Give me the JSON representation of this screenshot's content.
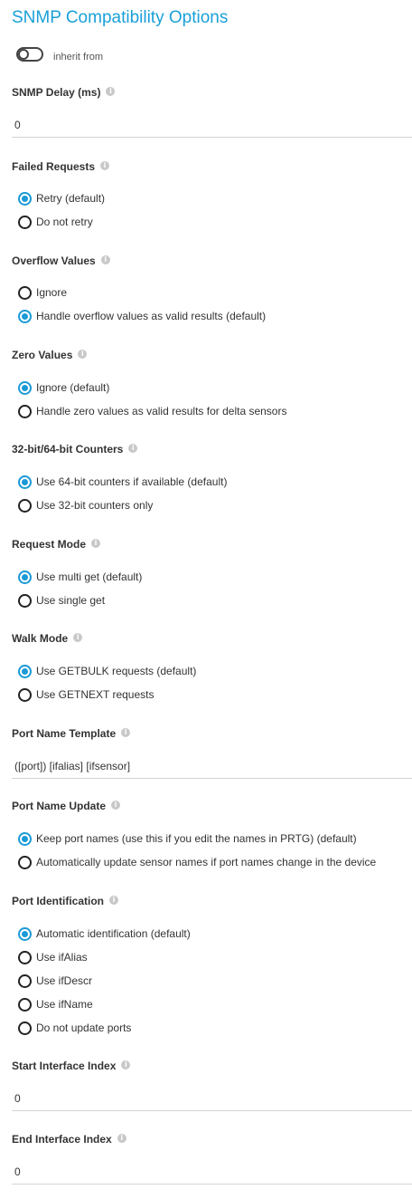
{
  "title": "SNMP Compatibility Options",
  "inherit": {
    "label": "inherit from",
    "on": false
  },
  "snmp_delay": {
    "label": "SNMP Delay (ms)",
    "value": "0"
  },
  "failed_requests": {
    "label": "Failed Requests",
    "options": [
      {
        "label": "Retry (default)",
        "checked": true
      },
      {
        "label": "Do not retry",
        "checked": false
      }
    ]
  },
  "overflow_values": {
    "label": "Overflow Values",
    "options": [
      {
        "label": "Ignore",
        "checked": false
      },
      {
        "label": "Handle overflow values as valid results (default)",
        "checked": true
      }
    ]
  },
  "zero_values": {
    "label": "Zero Values",
    "options": [
      {
        "label": "Ignore (default)",
        "checked": true
      },
      {
        "label": "Handle zero values as valid results for delta sensors",
        "checked": false
      }
    ]
  },
  "counters": {
    "label": "32-bit/64-bit Counters",
    "options": [
      {
        "label": "Use 64-bit counters if available (default)",
        "checked": true
      },
      {
        "label": "Use 32-bit counters only",
        "checked": false
      }
    ]
  },
  "request_mode": {
    "label": "Request Mode",
    "options": [
      {
        "label": "Use multi get (default)",
        "checked": true
      },
      {
        "label": "Use single get",
        "checked": false
      }
    ]
  },
  "walk_mode": {
    "label": "Walk Mode",
    "options": [
      {
        "label": "Use GETBULK requests (default)",
        "checked": true
      },
      {
        "label": "Use GETNEXT requests",
        "checked": false
      }
    ]
  },
  "port_name_template": {
    "label": "Port Name Template",
    "value": "([port]) [ifalias] [ifsensor]"
  },
  "port_name_update": {
    "label": "Port Name Update",
    "options": [
      {
        "label": "Keep port names (use this if you edit the names in PRTG) (default)",
        "checked": true
      },
      {
        "label": "Automatically update sensor names if port names change in the device",
        "checked": false
      }
    ]
  },
  "port_identification": {
    "label": "Port Identification",
    "options": [
      {
        "label": "Automatic identification (default)",
        "checked": true
      },
      {
        "label": "Use ifAlias",
        "checked": false
      },
      {
        "label": "Use ifDescr",
        "checked": false
      },
      {
        "label": "Use ifName",
        "checked": false
      },
      {
        "label": "Do not update ports",
        "checked": false
      }
    ]
  },
  "start_interface_index": {
    "label": "Start Interface Index",
    "value": "0"
  },
  "end_interface_index": {
    "label": "End Interface Index",
    "value": "0"
  },
  "icons": {
    "info": "info-icon",
    "radio": "radio-button",
    "toggle": "toggle-switch"
  },
  "colors": {
    "accent": "#1aa0d8",
    "text": "#333333",
    "divider": "#d5d5d5",
    "info_icon": "#c8c8c8"
  }
}
